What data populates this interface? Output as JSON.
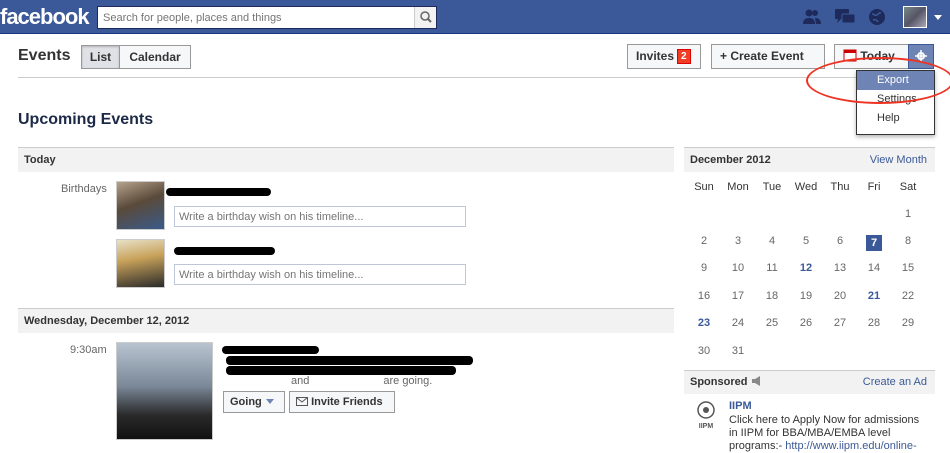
{
  "topbar": {
    "logo": "facebook",
    "search_placeholder": "Search for people, places and things"
  },
  "header": {
    "title": "Events",
    "list_label": "List",
    "calendar_label": "Calendar",
    "invites_label": "Invites",
    "invites_count": "2",
    "create_label": "+ Create Event",
    "today_label": "Today"
  },
  "dropdown": {
    "items": [
      "Export",
      "Settings",
      "Help"
    ]
  },
  "main": {
    "upcoming_title": "Upcoming Events",
    "section_today": "Today",
    "birthdays_label": "Birthdays",
    "wish_placeholder": "Write a birthday wish on his timeline...",
    "section_date": "Wednesday, December 12, 2012",
    "event_time": "9:30am",
    "going_suffix": "and",
    "going_end": "are going.",
    "going_btn": "Going",
    "invite_btn": "Invite Friends"
  },
  "calendar": {
    "month": "December 2012",
    "view_month": "View Month",
    "dow": [
      "Sun",
      "Mon",
      "Tue",
      "Wed",
      "Thu",
      "Fri",
      "Sat"
    ],
    "weeks": [
      [
        "",
        "",
        "",
        "",
        "",
        "",
        "1"
      ],
      [
        "2",
        "3",
        "4",
        "5",
        "6",
        "7",
        "8"
      ],
      [
        "9",
        "10",
        "11",
        "12",
        "13",
        "14",
        "15"
      ],
      [
        "16",
        "17",
        "18",
        "19",
        "20",
        "21",
        "22"
      ],
      [
        "23",
        "24",
        "25",
        "26",
        "27",
        "28",
        "29"
      ],
      [
        "30",
        "31",
        "",
        "",
        "",
        "",
        ""
      ]
    ],
    "today": "7",
    "event_days": [
      "12",
      "21",
      "23"
    ]
  },
  "sponsored": {
    "title": "Sponsored",
    "create_ad": "Create an Ad",
    "ad_title": "IIPM",
    "ad_text": "Click here to Apply Now for admissions in IIPM for BBA/MBA/EMBA level programs:-",
    "ad_link": "http://www.iipm.edu/online-",
    "ad_logo_text": "IIPM"
  }
}
